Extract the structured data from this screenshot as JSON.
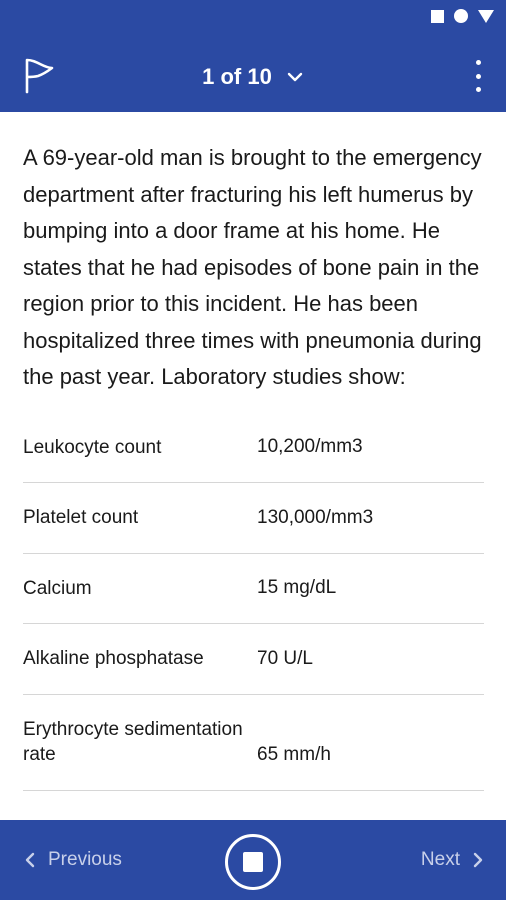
{
  "header": {
    "counter_text": "1 of 10",
    "flag_icon": "flag-icon",
    "menu_icon": "more-vert-icon"
  },
  "question": {
    "text": "A 69-year-old man is brought to the emergency department after fracturing his left humerus by bumping into a door frame at his home. He states that he had episodes of bone pain in the region prior to this incident. He has been hospitalized three times with pneumonia during the past year. Laboratory studies show:"
  },
  "labs": [
    {
      "name": "Leukocyte count",
      "value": "10,200/mm3"
    },
    {
      "name": "Platelet count",
      "value": "130,000/mm3"
    },
    {
      "name": "Calcium",
      "value": "15 mg/dL"
    },
    {
      "name": "Alkaline phosphatase",
      "value": "70 U/L"
    },
    {
      "name": "Erythrocyte sedimentation rate",
      "value": "65 mm/h"
    }
  ],
  "footer": {
    "previous_label": "Previous",
    "next_label": "Next"
  },
  "colors": {
    "primary": "#2b4aa3",
    "nav_text": "#c8d0ea"
  }
}
